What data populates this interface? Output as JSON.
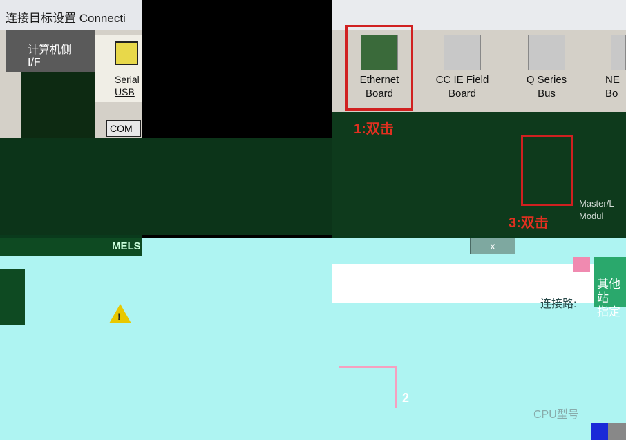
{
  "window": {
    "title": "连接目标设置 Connecti"
  },
  "pc_side": {
    "label_line1": "计算机侧",
    "label_line2": "I/F"
  },
  "serial": {
    "label_line1": "Serial",
    "label_line2": "USB"
  },
  "com": {
    "label": "COM"
  },
  "boards": [
    {
      "line1": "Ethernet",
      "line2": "Board"
    },
    {
      "line1": "CC IE Field",
      "line2": "Board"
    },
    {
      "line1": "Q Series",
      "line2": "Bus"
    },
    {
      "line1": "NE",
      "line2": "Bo"
    }
  ],
  "annotations": {
    "step1": "1:双击",
    "step3": "3:双击",
    "step2": "2"
  },
  "master": {
    "line1": "Master/L",
    "line2": "Modul"
  },
  "dialog": {
    "title": "MELS",
    "close": "x",
    "other_spec_line1": "其他站",
    "other_spec_line2": "指定",
    "connection_route": "连接路:",
    "cpu_model": "CPU型号"
  },
  "icons": {
    "warning": "warning-icon",
    "serial": "serial-port-icon",
    "ethernet": "ethernet-board-icon"
  },
  "colors": {
    "highlight": "#d02020",
    "cyan": "#aef4f2",
    "dark_green": "#0c3419"
  }
}
